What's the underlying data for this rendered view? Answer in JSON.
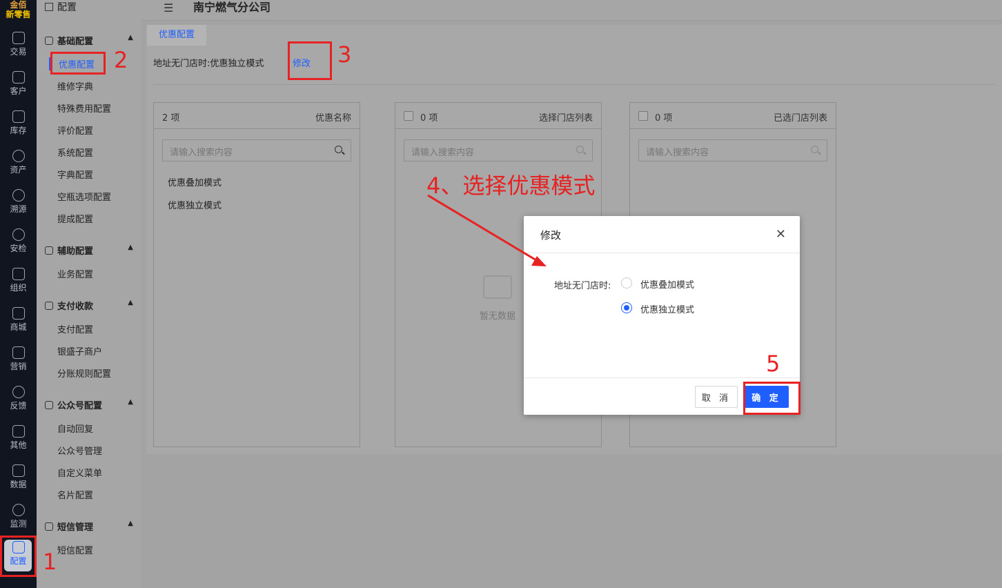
{
  "rail": {
    "brand_top": "金佰",
    "brand_bottom": "新零售",
    "items": [
      {
        "label": "交易",
        "icon": "bag-icon"
      },
      {
        "label": "客户",
        "icon": "id-card-icon"
      },
      {
        "label": "库存",
        "icon": "list-box-icon"
      },
      {
        "label": "资产",
        "icon": "bulb-icon"
      },
      {
        "label": "溯源",
        "icon": "compass-icon"
      },
      {
        "label": "安检",
        "icon": "shield-check-icon"
      },
      {
        "label": "组织",
        "icon": "org-chart-icon"
      },
      {
        "label": "商城",
        "icon": "store-icon"
      },
      {
        "label": "营销",
        "icon": "trophy-icon"
      },
      {
        "label": "反馈",
        "icon": "chat-icon"
      },
      {
        "label": "其他",
        "icon": "blocks-icon"
      },
      {
        "label": "数据",
        "icon": "line-chart-icon"
      },
      {
        "label": "监测",
        "icon": "alarm-icon"
      },
      {
        "label": "配置",
        "icon": "grid-icon"
      }
    ]
  },
  "submenu": {
    "header": "配置",
    "groups": [
      {
        "title": "基础配置",
        "items": [
          "优惠配置",
          "维修字典",
          "特殊费用配置",
          "评价配置",
          "系统配置",
          "字典配置",
          "空瓶选项配置",
          "提成配置"
        ]
      },
      {
        "title": "辅助配置",
        "items": [
          "业务配置"
        ]
      },
      {
        "title": "支付收款",
        "items": [
          "支付配置",
          "银盛子商户",
          "分账规则配置"
        ]
      },
      {
        "title": "公众号配置",
        "items": [
          "自动回复",
          "公众号管理",
          "自定义菜单",
          "名片配置"
        ]
      },
      {
        "title": "短信管理",
        "items": [
          "短信配置"
        ]
      }
    ]
  },
  "topbar": {
    "company": "南宁燃气分公司"
  },
  "main": {
    "tab": "优惠配置",
    "current_label": "地址无门店时:",
    "current_value": "优惠独立模式",
    "edit_link": "修改"
  },
  "panels": [
    {
      "count": "2 项",
      "title": "优惠名称",
      "placeholder": "请输入搜索内容",
      "items": [
        "优惠叠加模式",
        "优惠独立模式"
      ]
    },
    {
      "count": "0 项",
      "title": "选择门店列表",
      "placeholder": "请输入搜索内容",
      "empty": "暂无数据"
    },
    {
      "count": "0 项",
      "title": "已选门店列表",
      "placeholder": "请输入搜索内容"
    }
  ],
  "modal": {
    "title": "修改",
    "field_label": "地址无门店时:",
    "options": [
      "优惠叠加模式",
      "优惠独立模式"
    ],
    "selected": "优惠独立模式",
    "cancel": "取 消",
    "ok": "确 定"
  },
  "annotations": {
    "n1": "1",
    "n2": "2",
    "n3": "3",
    "n5": "5",
    "step4": "4、选择优惠模式",
    "color": "#e62222"
  }
}
